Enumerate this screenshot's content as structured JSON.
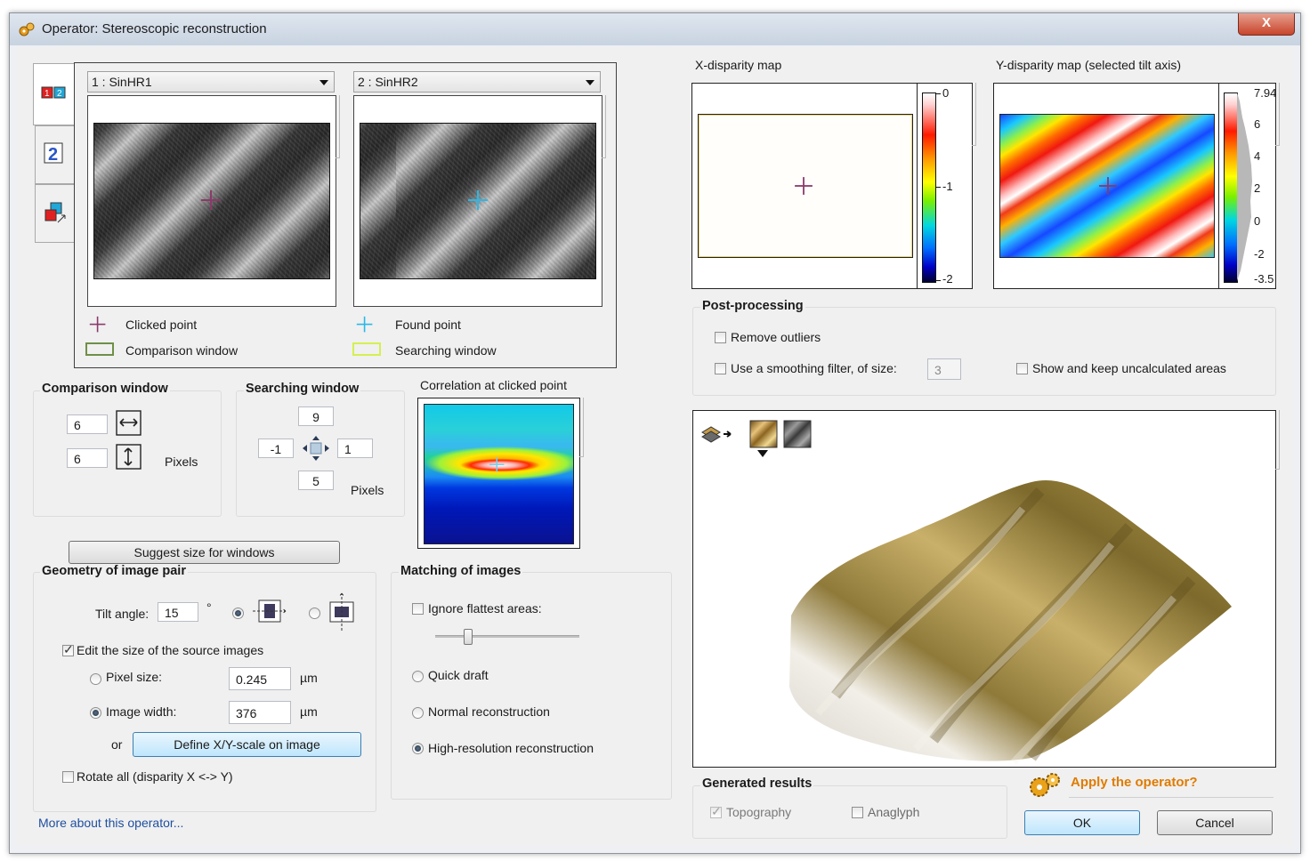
{
  "window": {
    "title": "Operator: Stereoscopic reconstruction",
    "close_label": "X"
  },
  "images": {
    "left_select": "1 : SinHR1",
    "right_select": "2 : SinHR2",
    "legend": {
      "clicked_point": "Clicked point",
      "found_point": "Found point",
      "comparison_window": "Comparison window",
      "searching_window": "Searching window"
    }
  },
  "comparison_window": {
    "title": "Comparison window",
    "width_value": "6",
    "height_value": "6",
    "unit": "Pixels"
  },
  "searching_window": {
    "title": "Searching window",
    "top_value": "9",
    "left_value": "-1",
    "right_value": "1",
    "bottom_value": "5",
    "unit": "Pixels"
  },
  "correlation": {
    "title": "Correlation at clicked point"
  },
  "suggest_button": "Suggest size for windows",
  "geometry": {
    "title": "Geometry of image pair",
    "tilt_label": "Tilt angle:",
    "tilt_value": "15",
    "tilt_unit": "°",
    "edit_size_label": "Edit the size of the source images",
    "pixel_size_label": "Pixel size:",
    "pixel_size_value": "0.245",
    "pixel_size_unit": "µm",
    "image_width_label": "Image width:",
    "image_width_value": "376",
    "image_width_unit": "µm",
    "or_label": "or",
    "define_scale_button": "Define X/Y-scale on image",
    "rotate_label": "Rotate all (disparity X <-> Y)"
  },
  "matching": {
    "title": "Matching of images",
    "ignore_flattest_label": "Ignore flattest areas:",
    "slider_level": 0.22,
    "quick_draft_label": "Quick draft",
    "normal_label": "Normal reconstruction",
    "high_res_label": "High-resolution reconstruction"
  },
  "more_link": "More about this operator...",
  "x_disparity": {
    "title": "X-disparity map",
    "ticks": [
      "0",
      "-1",
      "-2"
    ]
  },
  "y_disparity": {
    "title": "Y-disparity map (selected tilt axis)",
    "ticks": [
      "7.94",
      "6",
      "4",
      "2",
      "0",
      "-2",
      "-3.5"
    ]
  },
  "post_processing": {
    "title": "Post-processing",
    "remove_outliers_label": "Remove outliers",
    "smoothing_label": "Use a smoothing filter, of size:",
    "smoothing_value": "3",
    "show_uncalculated_label": "Show and keep uncalculated areas"
  },
  "generated": {
    "title": "Generated results",
    "topography_label": "Topography",
    "anaglyph_label": "Anaglyph"
  },
  "apply": {
    "question": "Apply the operator?",
    "ok": "OK",
    "cancel": "Cancel"
  }
}
